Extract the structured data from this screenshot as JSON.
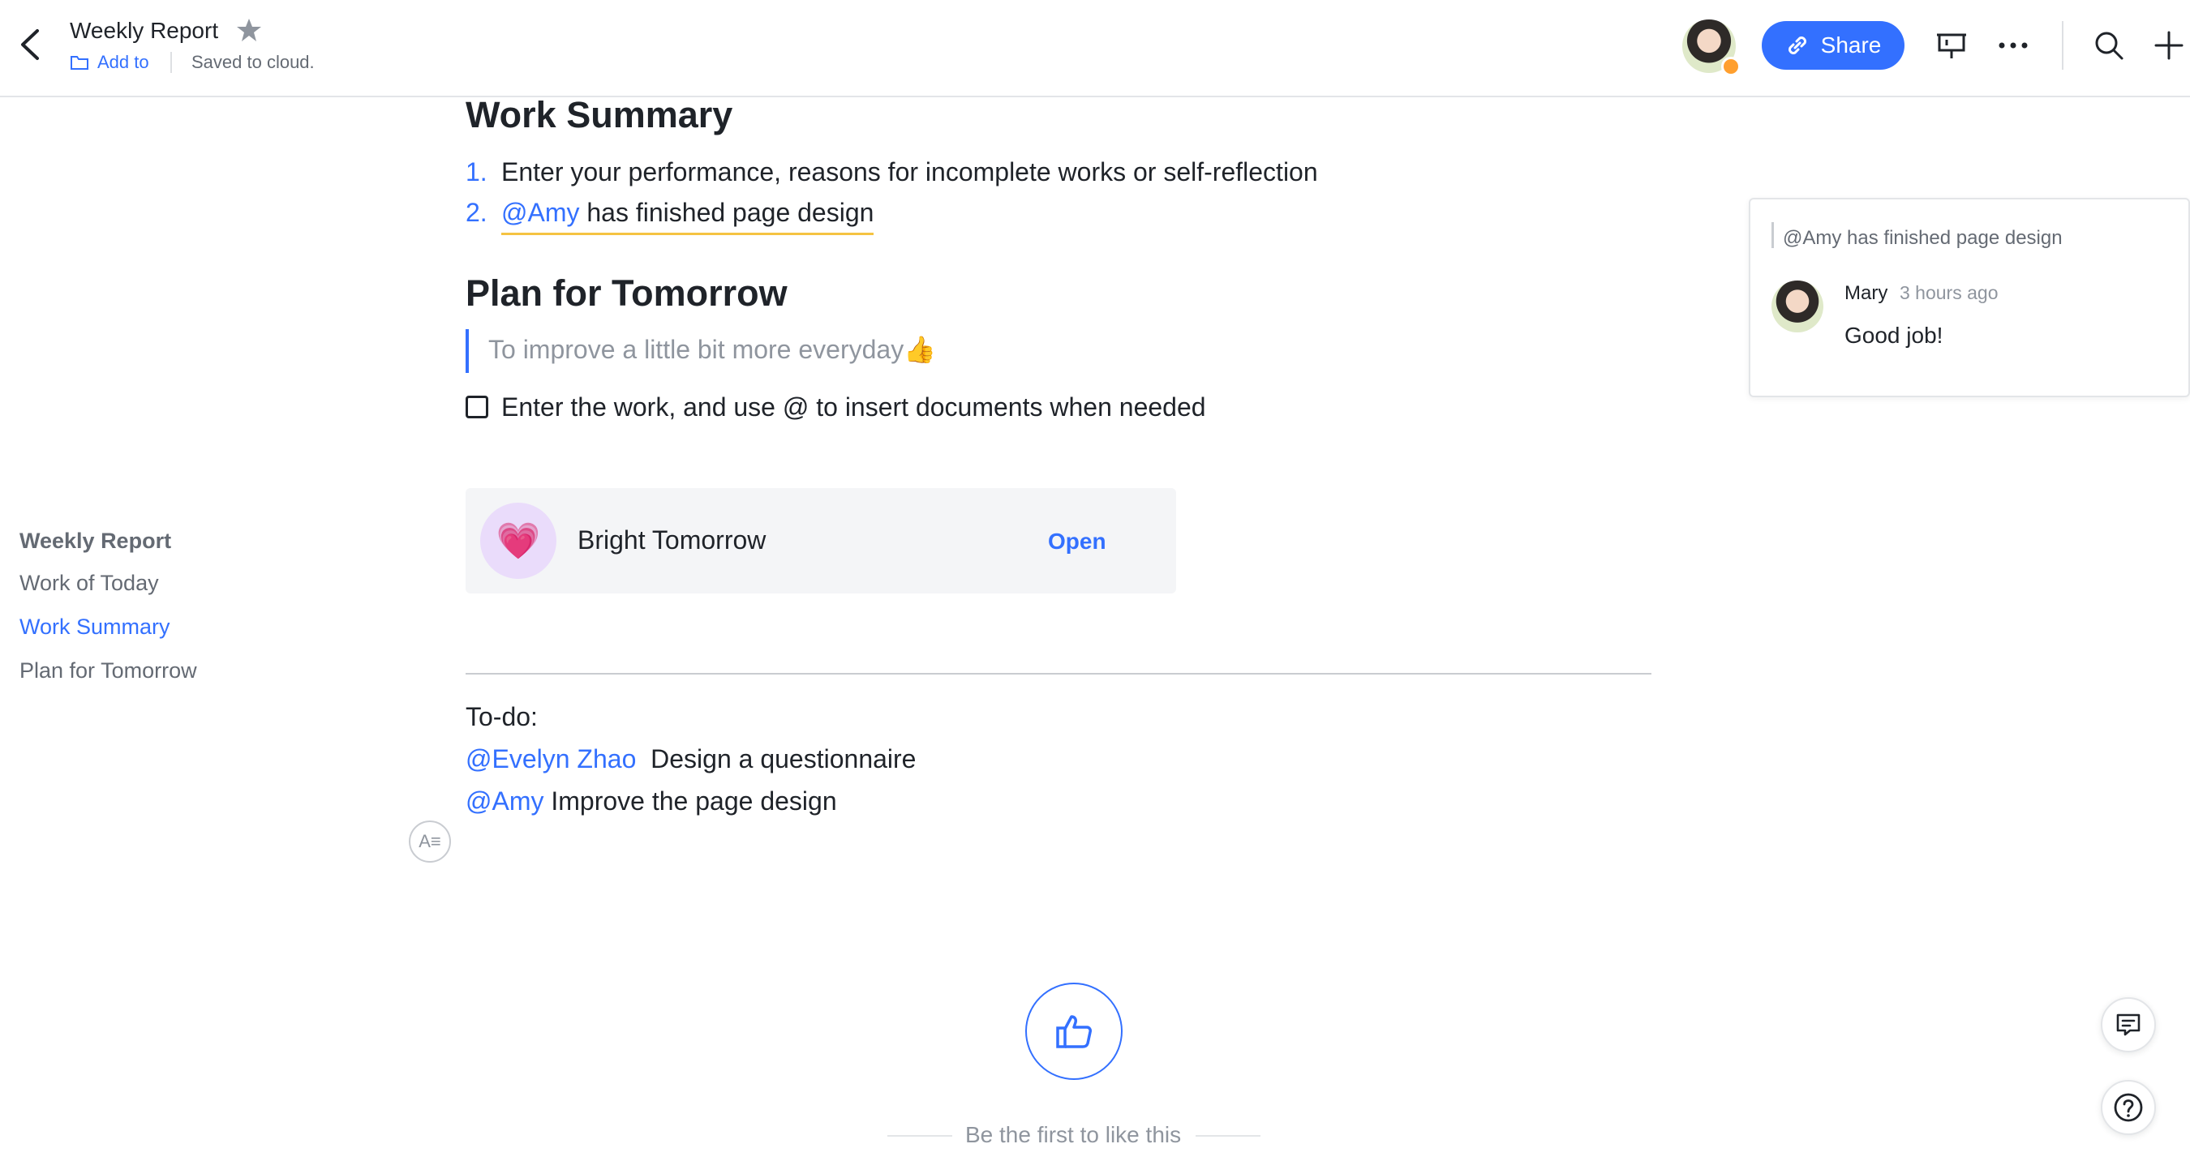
{
  "header": {
    "title": "Weekly Report",
    "add_to_label": "Add to",
    "save_status": "Saved to cloud.",
    "share_label": "Share"
  },
  "outline": {
    "title": "Weekly Report",
    "items": [
      {
        "label": "Work of Today"
      },
      {
        "label": "Work Summary"
      },
      {
        "label": "Plan for Tomorrow"
      }
    ]
  },
  "document": {
    "work_summary": {
      "heading": "Work Summary",
      "items": [
        {
          "num": "1.",
          "text": "Enter your performance, reasons for incomplete works or self-reflection"
        },
        {
          "num": "2.",
          "mention": "@Amy",
          "text": "has finished page design"
        }
      ]
    },
    "plan": {
      "heading": "Plan for Tomorrow",
      "quote": "To improve a little bit more everyday👍",
      "task": "Enter the work, and use @ to insert documents when needed"
    },
    "card": {
      "title": "Bright Tomorrow",
      "open_label": "Open",
      "emoji": "💗"
    },
    "todo": {
      "label": "To-do:",
      "rows": [
        {
          "mention": "@Evelyn Zhao",
          "text": "Design a questionnaire"
        },
        {
          "mention": "@Amy",
          "text": "Improve the page design"
        }
      ]
    },
    "style_button_label": "A≡"
  },
  "like": {
    "caption": "Be the first to like this"
  },
  "comment": {
    "quote": "@Amy has finished page design",
    "author": "Mary",
    "time": "3 hours ago",
    "text": "Good job!"
  },
  "colors": {
    "accent": "#3370ff",
    "comment_highlight": "#f5c342",
    "presence_dot": "#ff9f2e"
  }
}
